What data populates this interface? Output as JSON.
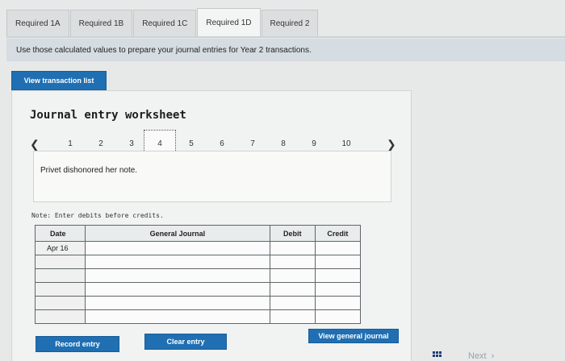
{
  "tabs": [
    {
      "label": "Required 1A",
      "active": false
    },
    {
      "label": "Required 1B",
      "active": false
    },
    {
      "label": "Required 1C",
      "active": false
    },
    {
      "label": "Required 1D",
      "active": true
    },
    {
      "label": "Required 2",
      "active": false
    }
  ],
  "instruction": "Use those calculated values to prepare your journal entries for Year 2 transactions.",
  "buttons": {
    "view_transactions": "View transaction list",
    "record_entry": "Record entry",
    "clear_entry": "Clear entry",
    "view_general_journal": "View general journal"
  },
  "worksheet": {
    "title": "Journal entry worksheet",
    "pages": [
      "1",
      "2",
      "3",
      "4",
      "5",
      "6",
      "7",
      "8",
      "9",
      "10"
    ],
    "current_page": "4",
    "prev_icon": "chevron-left-icon",
    "next_icon": "chevron-right-icon",
    "description": "Privet dishonored her note.",
    "note": "Note: Enter debits before credits."
  },
  "journal": {
    "headers": {
      "date": "Date",
      "account": "General Journal",
      "debit": "Debit",
      "credit": "Credit"
    },
    "rows": [
      {
        "date": "Apr 16",
        "account": "",
        "debit": "",
        "credit": ""
      },
      {
        "date": "",
        "account": "",
        "debit": "",
        "credit": ""
      },
      {
        "date": "",
        "account": "",
        "debit": "",
        "credit": ""
      },
      {
        "date": "",
        "account": "",
        "debit": "",
        "credit": ""
      },
      {
        "date": "",
        "account": "",
        "debit": "",
        "credit": ""
      },
      {
        "date": "",
        "account": "",
        "debit": "",
        "credit": ""
      }
    ]
  },
  "footer": {
    "next_label": "Next",
    "grid_icon": "grid-icon",
    "next_icon": "chevron-right-icon"
  },
  "colors": {
    "primary_button": "#1f6fb2",
    "instruction_bar": "#d5dde2",
    "background": "#e7e9e8"
  }
}
